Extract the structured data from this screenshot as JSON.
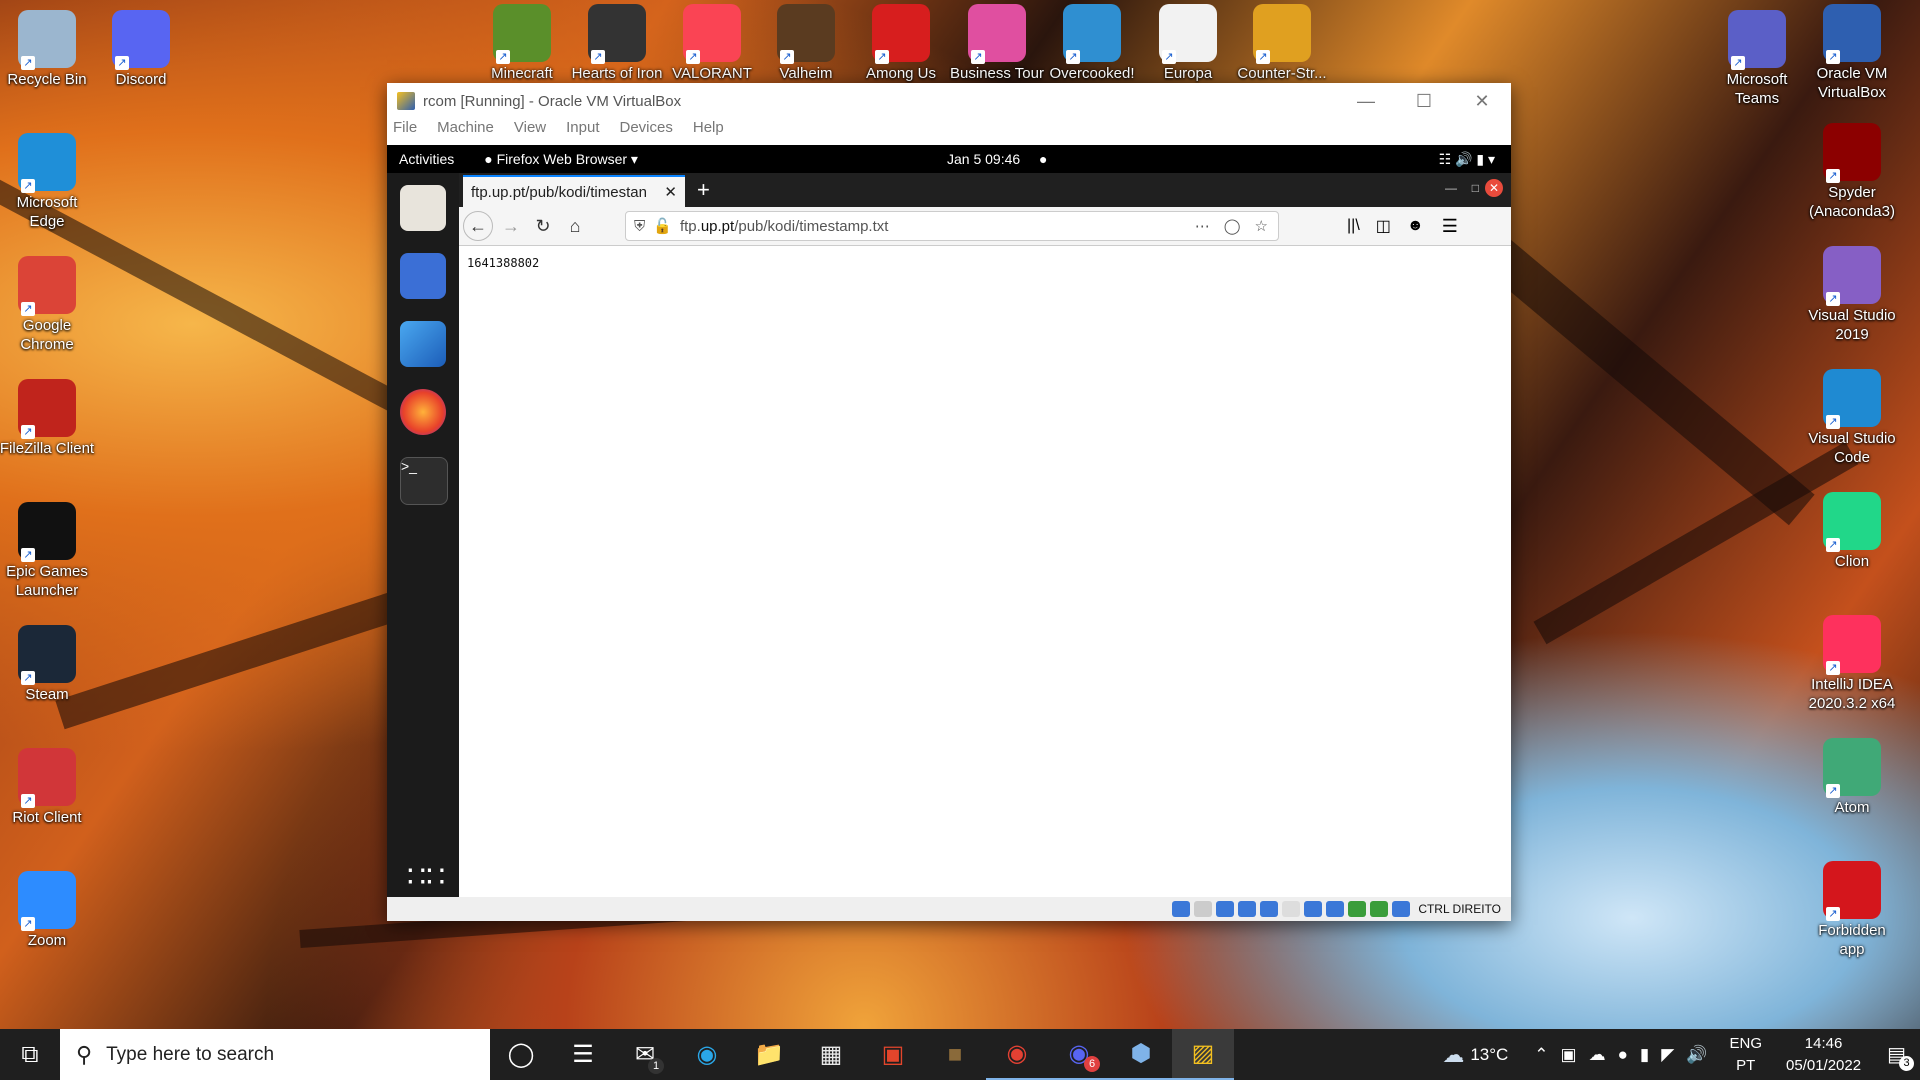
{
  "desktop": {
    "left_icons": [
      {
        "label": "Recycle Bin",
        "icon": "recycle-bin-icon",
        "color": "#9bb6cf"
      },
      {
        "label": "Microsoft Edge",
        "icon": "edge-icon",
        "color": "#1f8fd8"
      },
      {
        "label": "Google Chrome",
        "icon": "chrome-icon",
        "color": "#db4437"
      },
      {
        "label": "FileZilla Client",
        "icon": "filezilla-icon",
        "color": "#c0241c"
      },
      {
        "label": "Epic Games Launcher",
        "icon": "epic-games-icon",
        "color": "#111111"
      },
      {
        "label": "Steam",
        "icon": "steam-icon",
        "color": "#1b2838"
      },
      {
        "label": "Riot Client",
        "icon": "riot-client-icon",
        "color": "#d13639"
      },
      {
        "label": "Zoom",
        "icon": "zoom-icon",
        "color": "#2d8cff"
      }
    ],
    "second_col_icons": [
      {
        "label": "Discord",
        "icon": "discord-icon",
        "color": "#5865f2"
      }
    ],
    "top_icons": [
      {
        "label": "Minecraft",
        "icon": "minecraft-icon",
        "color": "#5a8f2a"
      },
      {
        "label": "Hearts of Iron",
        "icon": "hearts-of-iron-icon",
        "color": "#333333"
      },
      {
        "label": "VALORANT",
        "icon": "valorant-icon",
        "color": "#fa4454"
      },
      {
        "label": "Valheim",
        "icon": "valheim-icon",
        "color": "#5a3b20"
      },
      {
        "label": "Among Us",
        "icon": "among-us-icon",
        "color": "#d71e1e"
      },
      {
        "label": "Business Tour",
        "icon": "business-tour-icon",
        "color": "#e04fa0"
      },
      {
        "label": "Overcooked!",
        "icon": "overcooked-icon",
        "color": "#2f8fd1"
      },
      {
        "label": "Europa",
        "icon": "europa-file-icon",
        "color": "#f2f2f2"
      },
      {
        "label": "Counter-Str...",
        "icon": "csgo-icon",
        "color": "#e0a020"
      }
    ],
    "right_icons": [
      {
        "label": "Microsoft Teams",
        "icon": "teams-icon",
        "color": "#5b5fc7"
      },
      {
        "label": "Spyder (Anaconda3)",
        "icon": "spyder-icon",
        "color": "#8c0000"
      },
      {
        "label": "Visual Studio 2019",
        "icon": "visual-studio-icon",
        "color": "#865fc5"
      },
      {
        "label": "Visual Studio Code",
        "icon": "vscode-icon",
        "color": "#1f8ad2"
      },
      {
        "label": "Clion",
        "icon": "clion-icon",
        "color": "#21d789"
      },
      {
        "label": "IntelliJ IDEA 2020.3.2 x64",
        "icon": "intellij-icon",
        "color": "#fe315d"
      },
      {
        "label": "Atom",
        "icon": "atom-icon",
        "color": "#40a977"
      },
      {
        "label": "Forbidden app",
        "icon": "pdf-icon",
        "color": "#d4161c"
      }
    ],
    "right_top_icon": {
      "label": "Oracle VM VirtualBox",
      "icon": "virtualbox-icon",
      "color": "#2e5fb0"
    }
  },
  "vbox": {
    "title": "rcom [Running] - Oracle VM VirtualBox",
    "menu": [
      "File",
      "Machine",
      "View",
      "Input",
      "Devices",
      "Help"
    ],
    "status_text": "CTRL DIREITO"
  },
  "gnome": {
    "activities": "Activities",
    "app": "Firefox Web Browser",
    "clock": "Jan 5  09:46"
  },
  "firefox": {
    "tab_title": "ftp.up.pt/pub/kodi/timestan",
    "url_prefix": "ftp.",
    "url_host": "up.pt",
    "url_path": "/pub/kodi/timestamp.txt",
    "page_text": "1641388802"
  },
  "taskbar": {
    "search_placeholder": "Type here to search",
    "weather": "13°C",
    "lang_top": "ENG",
    "lang_bottom": "PT",
    "time": "14:46",
    "date": "05/01/2022",
    "notification_count": "3",
    "mail_badge": "1",
    "discord_badge": "6"
  },
  "colors": {
    "accent": "#0a84ff",
    "taskbar": "#1f1f1f",
    "gnome_bar": "#000000"
  }
}
